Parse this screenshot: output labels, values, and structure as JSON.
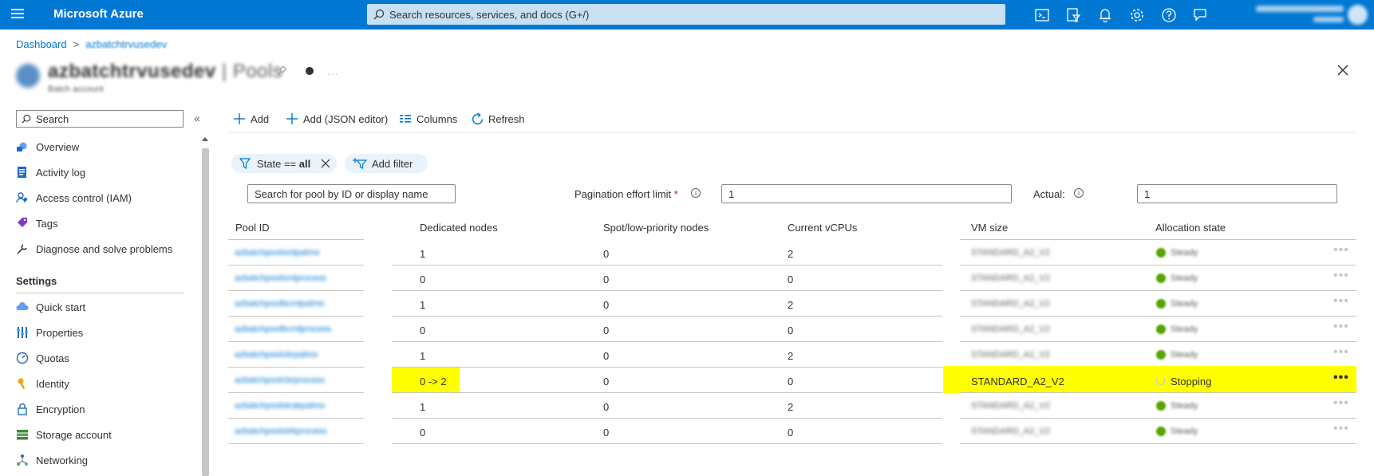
{
  "topbar": {
    "brand": "Microsoft Azure",
    "search_placeholder": "Search resources, services, and docs (G+/)",
    "icons": [
      "cloud-shell-icon",
      "directory-filter-icon",
      "notifications-icon",
      "settings-icon",
      "help-icon",
      "feedback-icon"
    ],
    "color": "#0078d4"
  },
  "breadcrumb": {
    "items": [
      "Dashboard",
      "azbatchtrvusedev"
    ]
  },
  "header": {
    "resource_name": "azbatchtrvusedev",
    "separator": "|",
    "page_name": "Pools",
    "subtitle": "Batch account"
  },
  "nav": {
    "search_placeholder": "Search",
    "collapse_label": "«",
    "items": [
      {
        "label": "Overview",
        "icon": "overview-icon"
      },
      {
        "label": "Activity log",
        "icon": "activity-log-icon"
      },
      {
        "label": "Access control (IAM)",
        "icon": "iam-icon"
      },
      {
        "label": "Tags",
        "icon": "tag-icon"
      },
      {
        "label": "Diagnose and solve problems",
        "icon": "wrench-icon"
      }
    ],
    "settings_heading": "Settings",
    "settings_items": [
      {
        "label": "Quick start",
        "icon": "cloud-icon"
      },
      {
        "label": "Properties",
        "icon": "properties-icon"
      },
      {
        "label": "Quotas",
        "icon": "quotas-icon"
      },
      {
        "label": "Identity",
        "icon": "key-icon"
      },
      {
        "label": "Encryption",
        "icon": "lock-icon"
      },
      {
        "label": "Storage account",
        "icon": "storage-icon"
      },
      {
        "label": "Networking",
        "icon": "network-icon"
      }
    ]
  },
  "toolbar": {
    "add": "Add",
    "add_json": "Add (JSON editor)",
    "columns": "Columns",
    "refresh": "Refresh"
  },
  "filters": {
    "state_label": "State == ",
    "state_value": "all",
    "add_filter": "Add filter",
    "pool_search_placeholder": "Search for pool by ID or display name",
    "pagination_label": "Pagination effort limit",
    "pagination_required": "*",
    "pagination_value": "1",
    "actual_label": "Actual:",
    "actual_value": "1"
  },
  "table": {
    "columns": [
      "Pool ID",
      "Dedicated nodes",
      "Spot/low-priority nodes",
      "Current vCPUs",
      "VM size",
      "Allocation state"
    ],
    "rows": [
      {
        "pool_id": "azbatchpoolsmlpalmo",
        "dedicated": "1",
        "spot": "0",
        "vcpus": "2",
        "vm_size": "STANDARD_A2_V2",
        "state": "Steady"
      },
      {
        "pool_id": "azbatchpoolsmlprocess",
        "dedicated": "0",
        "spot": "0",
        "vcpus": "0",
        "vm_size": "STANDARD_A2_V2",
        "state": "Steady"
      },
      {
        "pool_id": "azbatchpoolbcmlpalmo",
        "dedicated": "1",
        "spot": "0",
        "vcpus": "2",
        "vm_size": "STANDARD_A2_V2",
        "state": "Steady"
      },
      {
        "pool_id": "azbatchpoolbcmlprocess",
        "dedicated": "0",
        "spot": "0",
        "vcpus": "0",
        "vm_size": "STANDARD_A2_V2",
        "state": "Steady"
      },
      {
        "pool_id": "azbatchpoolcbrpalmo",
        "dedicated": "1",
        "spot": "0",
        "vcpus": "2",
        "vm_size": "STANDARD_A2_V2",
        "state": "Steady"
      },
      {
        "pool_id": "azbatchpoolcbrprocess",
        "dedicated": "0 -> 2",
        "spot": "0",
        "vcpus": "0",
        "vm_size": "STANDARD_A2_V2",
        "state": "Stopping"
      },
      {
        "pool_id": "azbatchpoolstrakpalmo",
        "dedicated": "1",
        "spot": "0",
        "vcpus": "2",
        "vm_size": "STANDARD_A2_V2",
        "state": "Steady"
      },
      {
        "pool_id": "azbatchpoolstrkprocess",
        "dedicated": "0",
        "spot": "0",
        "vcpus": "0",
        "vm_size": "STANDARD_A2_V2",
        "state": "Steady"
      }
    ],
    "row_more": "•••",
    "highlight_color": "#ffff00",
    "steady_color": "#57a300"
  }
}
